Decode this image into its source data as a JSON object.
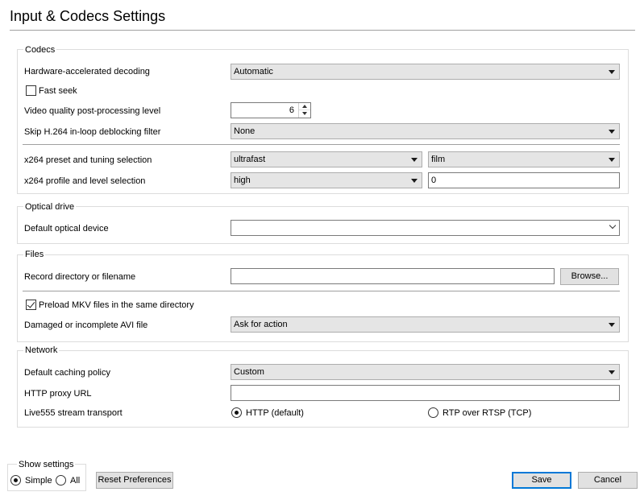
{
  "window": {
    "title": "Input & Codecs Settings"
  },
  "codecs": {
    "title": "Codecs",
    "hw_decoding": {
      "label": "Hardware-accelerated decoding",
      "value": "Automatic"
    },
    "fast_seek": {
      "label": "Fast seek",
      "checked": false
    },
    "pp_level": {
      "label": "Video quality post-processing level",
      "value": "6"
    },
    "skip_h264": {
      "label": "Skip H.264 in-loop deblocking filter",
      "value": "None"
    },
    "x264_preset": {
      "label": "x264 preset and tuning selection",
      "preset": "ultrafast",
      "tuning": "film"
    },
    "x264_profile": {
      "label": "x264 profile and level selection",
      "profile": "high",
      "level": "0"
    }
  },
  "optical": {
    "title": "Optical drive",
    "device": {
      "label": "Default optical device",
      "value": ""
    }
  },
  "files": {
    "title": "Files",
    "record": {
      "label": "Record directory or filename",
      "value": "",
      "browse_label": "Browse..."
    },
    "preload_mkv": {
      "label": "Preload MKV files in the same directory",
      "checked": true
    },
    "damaged_avi": {
      "label": "Damaged or incomplete AVI file",
      "value": "Ask for action"
    }
  },
  "network": {
    "title": "Network",
    "caching": {
      "label": "Default caching policy",
      "value": "Custom"
    },
    "proxy": {
      "label": "HTTP proxy URL",
      "value": ""
    },
    "transport": {
      "label": "Live555 stream transport",
      "options": [
        "HTTP (default)",
        "RTP over RTSP (TCP)"
      ],
      "selected": "HTTP (default)"
    }
  },
  "footer": {
    "show_settings": {
      "title": "Show settings",
      "options": [
        "Simple",
        "All"
      ],
      "selected": "Simple"
    },
    "reset_label": "Reset Preferences",
    "save_label": "Save",
    "cancel_label": "Cancel"
  }
}
